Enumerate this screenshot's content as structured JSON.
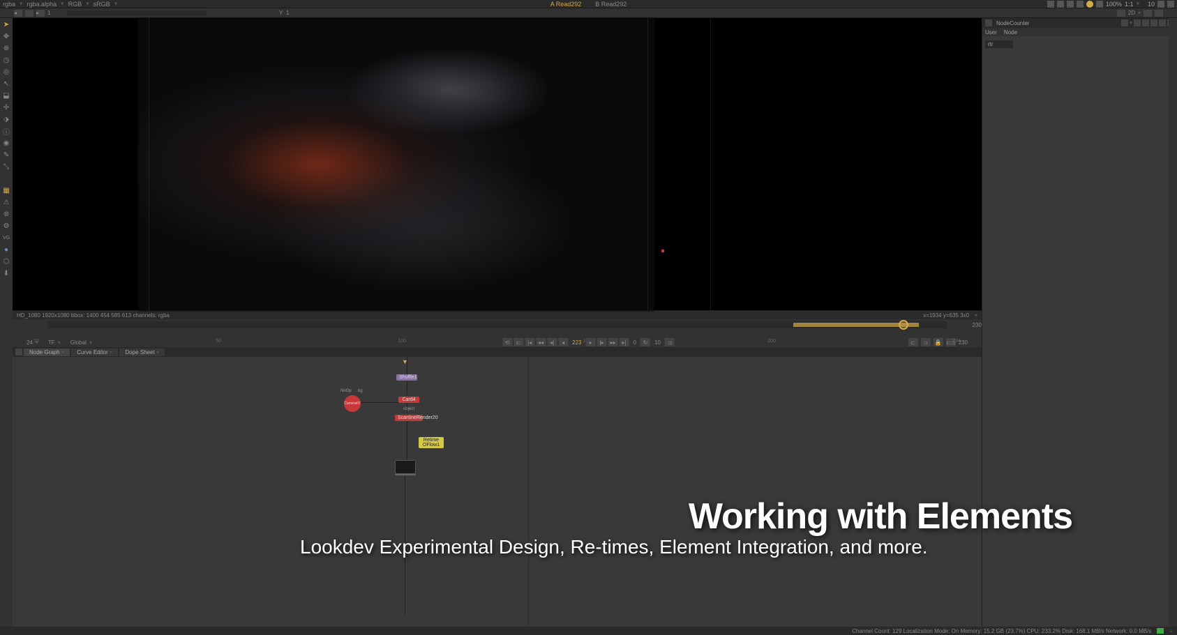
{
  "topBar": {
    "channels": {
      "c1": "rgba",
      "c2": "rgba.alpha",
      "c3": "RGB",
      "c4": "sRGB"
    },
    "tabA": "A  Read292",
    "tabB": "B  Read292",
    "zoom": "100%",
    "ratio": "1:1",
    "frameNum": "10"
  },
  "viewerControls": {
    "leftLabel": "1",
    "dimBtn": "2D"
  },
  "viewerStatus": {
    "left": "HD_1080 1920x1080   bbox: 1400 454 585 613 channels: rgba",
    "right": "x=1934 y=635 3x0"
  },
  "timeline": {
    "marks": [
      "10",
      "50",
      "100",
      "150",
      "200",
      "234"
    ],
    "end": "230"
  },
  "playback": {
    "fps": "24",
    "tf": "TF",
    "mode": "Global",
    "current": "223",
    "skipVal": "10",
    "zero": "0",
    "endFrame": "230"
  },
  "tabs": {
    "t1": "Node Graph",
    "t2": "Curve Editor",
    "t3": "Dope Sheet"
  },
  "nodes": {
    "shuffle": "Shuffle1",
    "camera": "Camera07",
    "card": "Card4",
    "scanline": "ScanlineRender20",
    "retime": "Retime OFlow1",
    "noop": "NoOp",
    "object": "object"
  },
  "rightPanel": {
    "title": "NodeCounter",
    "tab1": "User",
    "tab2": "Node",
    "prop": "rtr"
  },
  "overlay": {
    "title": "Working with Elements",
    "subtitle": "Lookdev Experimental Design, Re-times, Element Integration, and more."
  },
  "bottomStatus": {
    "text": "Channel Count: 129  Localization Mode: On  Memory: 15.2 GB (23.7%)  CPU: 233.2%  Disk: 168.1 MB/s Network: 0.0 MB/s"
  }
}
